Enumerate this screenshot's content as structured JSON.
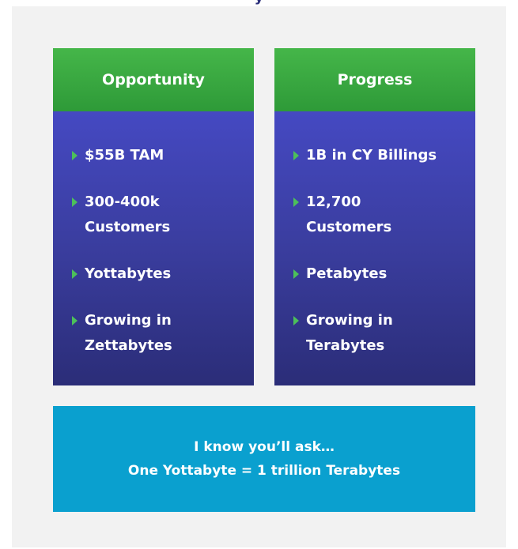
{
  "header": {
    "title_fragment": "y"
  },
  "opportunity": {
    "heading": "Opportunity",
    "items": [
      "$55B TAM",
      "300-400k Customers",
      "Yottabytes",
      "Growing in Zettabytes"
    ]
  },
  "progress": {
    "heading": "Progress",
    "items": [
      "1B in CY Billings",
      "12,700 Customers",
      "Petabytes",
      "Growing in Terabytes"
    ]
  },
  "callout": {
    "line1": "I know you’ll ask…",
    "line2": "One Yottabyte = 1 trillion Terabytes"
  },
  "colors": {
    "header_green": "#3aa843",
    "body_blue": "#3a3d9e",
    "callout_cyan": "#0aa0cf",
    "arrow_green": "#4cc05a",
    "panel_gray": "#f2f2f2"
  }
}
